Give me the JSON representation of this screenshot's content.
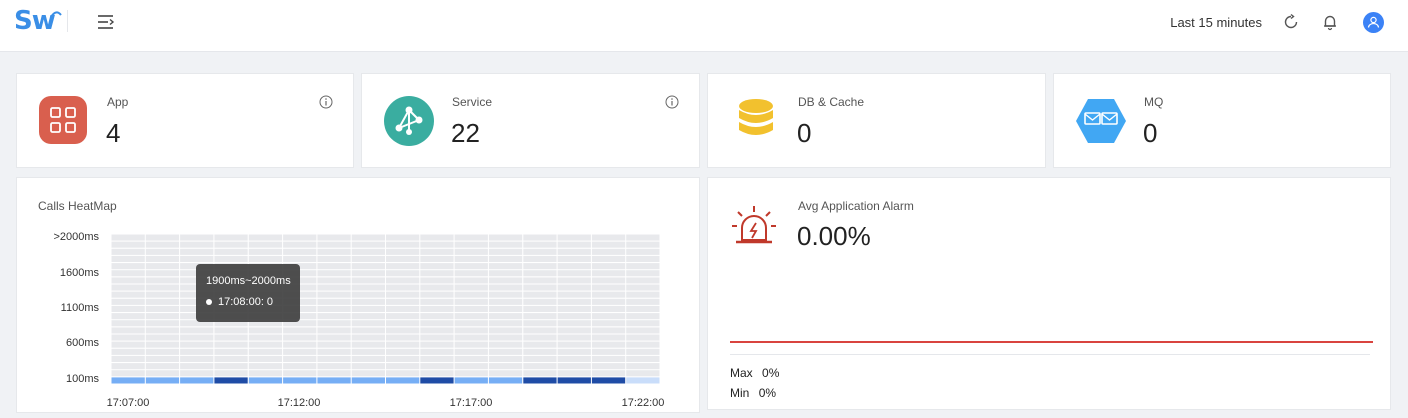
{
  "header": {
    "logo": "Sw",
    "time_range": "Last 15 minutes",
    "icons": [
      "menu-toggle-icon",
      "refresh-icon",
      "bell-icon",
      "user-icon"
    ]
  },
  "stats": [
    {
      "label": "App",
      "value": "4",
      "icon": "apps-grid-icon",
      "color": "#d95f4e",
      "info": true
    },
    {
      "label": "Service",
      "value": "22",
      "icon": "service-graph-icon",
      "color": "#3aada0",
      "info": true
    },
    {
      "label": "DB & Cache",
      "value": "0",
      "icon": "database-icon",
      "color": "#f2c12e",
      "info": false
    },
    {
      "label": "MQ",
      "value": "0",
      "icon": "mq-envelope-icon",
      "color": "#41a7f3",
      "info": false
    }
  ],
  "heatmap": {
    "title": "Calls HeatMap",
    "tooltip": {
      "title": "1900ms~2000ms",
      "row": "17:08:00: 0"
    }
  },
  "alarm": {
    "label": "Avg Application Alarm",
    "value": "0.00%",
    "max_label": "Max",
    "max_value": "0%",
    "min_label": "Min",
    "min_value": "0%",
    "line_color": "#d9443f"
  },
  "chart_data": {
    "type": "heatmap",
    "title": "Calls HeatMap",
    "y_ticks": [
      ">2000ms",
      "1600ms",
      "1100ms",
      "600ms",
      "100ms"
    ],
    "x_ticks": [
      "17:07:00",
      "17:12:00",
      "17:17:00",
      "17:22:00"
    ],
    "x_columns": 16,
    "rows": 21,
    "bottom_row_levels": [
      1,
      1,
      1,
      2,
      1,
      1,
      1,
      1,
      1,
      2,
      1,
      1,
      2,
      2,
      2,
      0
    ],
    "colors": {
      "empty": "#e8e9ec",
      "low": "#76aef5",
      "high": "#1f4ca6",
      "lowest": "#c9ddfa"
    }
  }
}
